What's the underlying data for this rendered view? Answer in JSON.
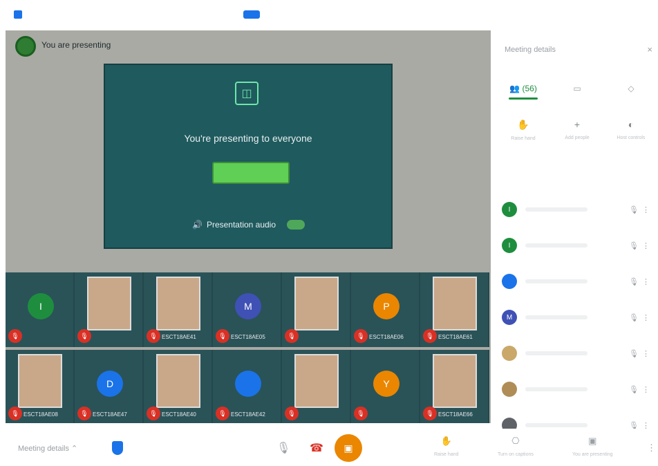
{
  "stage": {
    "presenting_label": "You are presenting",
    "present_heading": "You're presenting to everyone",
    "audio_label": "Presentation audio"
  },
  "tiles_row1": [
    {
      "name": "",
      "type": "avatar",
      "initial": "I",
      "color": "#1e8e3e"
    },
    {
      "name": "",
      "type": "photo"
    },
    {
      "name": "ESCT18AE41",
      "type": "photo"
    },
    {
      "name": "ESCT18AE05",
      "type": "avatar",
      "initial": "M",
      "color": "#3f51b5"
    },
    {
      "name": "",
      "type": "photo"
    },
    {
      "name": "ESCT18AE06",
      "type": "avatar",
      "initial": "P",
      "color": "#ea8600"
    },
    {
      "name": "ESCT18AE61",
      "type": "photo"
    }
  ],
  "tiles_row2": [
    {
      "name": "ESCT18AE08",
      "type": "photo"
    },
    {
      "name": "ESCT18AE47",
      "type": "avatar",
      "initial": "D",
      "color": "#1a73e8"
    },
    {
      "name": "ESCT18AE40",
      "type": "photo"
    },
    {
      "name": "ESCT18AE42",
      "type": "avatar",
      "initial": "",
      "color": "#1a73e8"
    },
    {
      "name": "",
      "type": "photo"
    },
    {
      "name": "",
      "type": "avatar",
      "initial": "Y",
      "color": "#ea8600"
    },
    {
      "name": "ESCT18AE66",
      "type": "photo"
    }
  ],
  "panel": {
    "title": "Meeting details",
    "close": "×",
    "tabs": [
      "(56)",
      "",
      ""
    ],
    "actions": [
      {
        "icon": "hand-icon",
        "glyph": "✋",
        "label": "Raise hand"
      },
      {
        "icon": "add-person-icon",
        "glyph": "+",
        "label": "Add people"
      },
      {
        "icon": "host-controls-icon",
        "glyph": "◐",
        "label": "Host controls"
      }
    ],
    "participants": [
      {
        "initial": "I",
        "color": "#1e8e3e"
      },
      {
        "initial": "I",
        "color": "#1e8e3e"
      },
      {
        "initial": "",
        "color": "#1a73e8"
      },
      {
        "initial": "M",
        "color": "#3f51b5"
      },
      {
        "initial": "",
        "color": "#c9a86a"
      },
      {
        "initial": "",
        "color": "#b08d57"
      },
      {
        "initial": "",
        "color": "#5f6368"
      }
    ]
  },
  "bottom": {
    "meeting_details": "Meeting details ⌃",
    "controls": [
      {
        "icon": "raise-hand-icon",
        "glyph": "✋",
        "label": "Raise hand"
      },
      {
        "icon": "captions-icon",
        "glyph": "⎔",
        "label": "Turn on captions"
      },
      {
        "icon": "present-now-icon",
        "glyph": "▣",
        "label": "You are presenting"
      }
    ]
  }
}
